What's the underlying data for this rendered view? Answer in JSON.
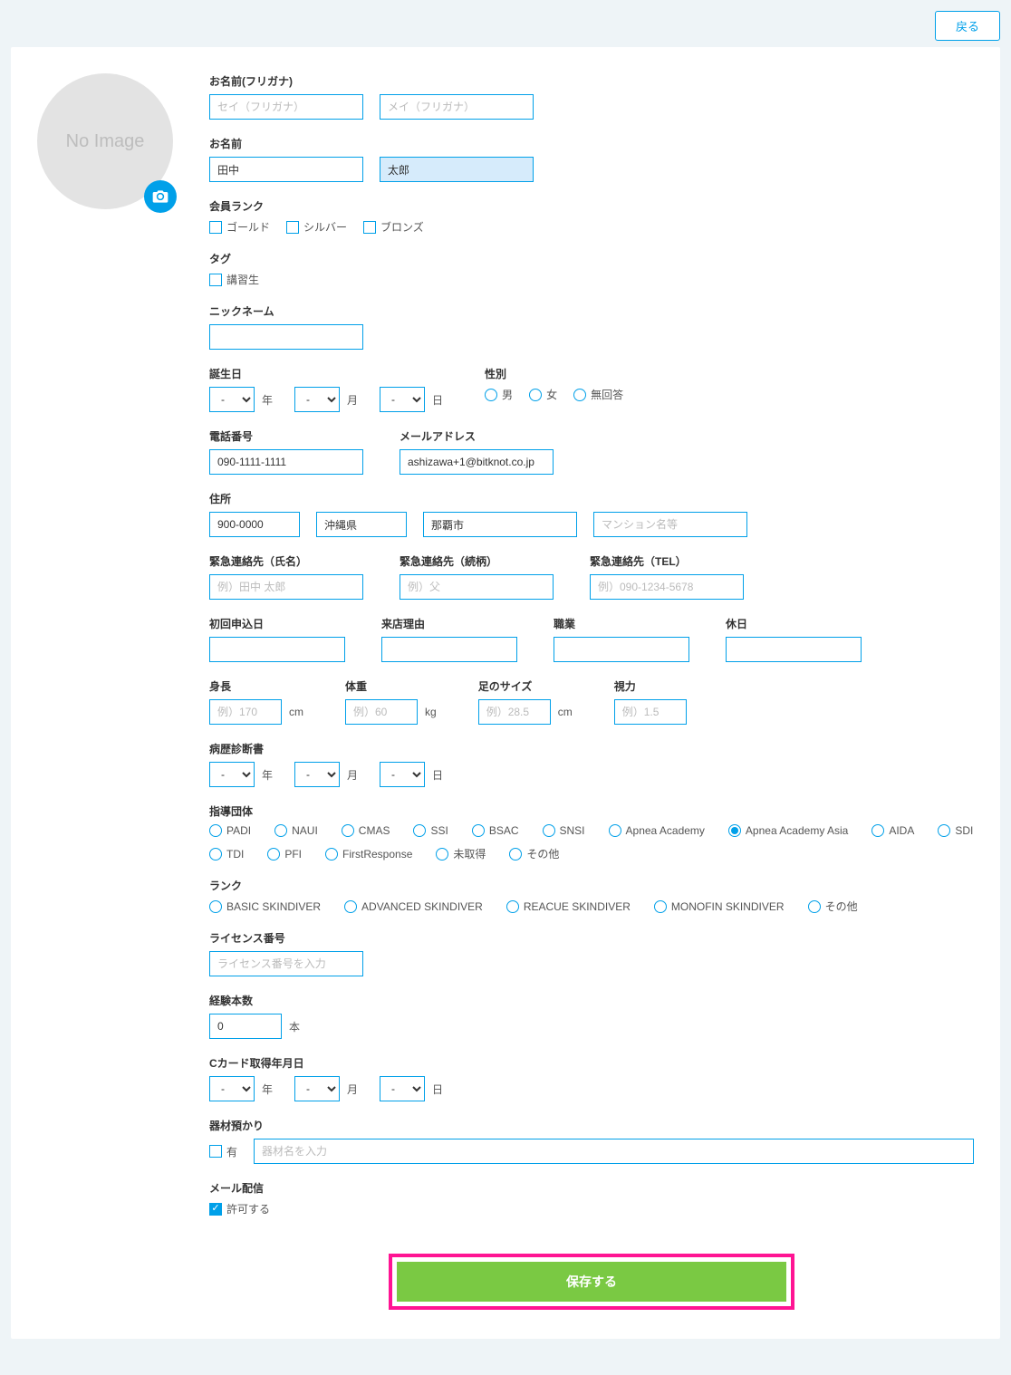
{
  "header": {
    "back": "戻る"
  },
  "avatar": {
    "placeholder": "No Image"
  },
  "furigana": {
    "label": "お名前(フリガナ)",
    "sei_ph": "セイ（フリガナ）",
    "mei_ph": "メイ（フリガナ）"
  },
  "name": {
    "label": "お名前",
    "sei": "田中",
    "mei": "太郎"
  },
  "rank": {
    "label": "会員ランク",
    "opts": [
      "ゴールド",
      "シルバー",
      "ブロンズ"
    ]
  },
  "tag": {
    "label": "タグ",
    "opts": [
      "講習生"
    ]
  },
  "nickname": {
    "label": "ニックネーム"
  },
  "birth": {
    "label": "誕生日",
    "year": "年",
    "month": "月",
    "day": "日",
    "dash": "-"
  },
  "gender": {
    "label": "性別",
    "opts": [
      "男",
      "女",
      "無回答"
    ]
  },
  "phone": {
    "label": "電話番号",
    "value": "090-1111-1111"
  },
  "email": {
    "label": "メールアドレス",
    "value": "ashizawa+1@bitknot.co.jp"
  },
  "address": {
    "label": "住所",
    "zip": "900-0000",
    "pref": "沖縄県",
    "city": "那覇市",
    "bldg_ph": "マンション名等"
  },
  "emerg": {
    "name_label": "緊急連絡先（氏名）",
    "name_ph": "例）田中 太郎",
    "rel_label": "緊急連絡先（続柄）",
    "rel_ph": "例）父",
    "tel_label": "緊急連絡先（TEL）",
    "tel_ph": "例）090-1234-5678"
  },
  "first": {
    "label": "初回申込日"
  },
  "reason": {
    "label": "来店理由"
  },
  "job": {
    "label": "職業"
  },
  "holiday": {
    "label": "休日"
  },
  "body": {
    "height_label": "身長",
    "height_ph": "例）170",
    "height_unit": "cm",
    "weight_label": "体重",
    "weight_ph": "例）60",
    "weight_unit": "kg",
    "foot_label": "足のサイズ",
    "foot_ph": "例）28.5",
    "foot_unit": "cm",
    "eye_label": "視力",
    "eye_ph": "例）1.5"
  },
  "medical": {
    "label": "病歴診断書",
    "year": "年",
    "month": "月",
    "day": "日",
    "dash": "-"
  },
  "org": {
    "label": "指導団体",
    "opts": [
      "PADI",
      "NAUI",
      "CMAS",
      "SSI",
      "BSAC",
      "SNSI",
      "Apnea Academy",
      "Apnea Academy Asia",
      "AIDA",
      "SDI",
      "TDI",
      "PFI",
      "FirstResponse",
      "未取得",
      "その他"
    ],
    "selected": "Apnea Academy Asia"
  },
  "level": {
    "label": "ランク",
    "opts": [
      "BASIC SKINDIVER",
      "ADVANCED SKINDIVER",
      "REACUE SKINDIVER",
      "MONOFIN SKINDIVER",
      "その他"
    ]
  },
  "license": {
    "label": "ライセンス番号",
    "ph": "ライセンス番号を入力"
  },
  "exp": {
    "label": "経験本数",
    "value": "0",
    "unit": "本"
  },
  "ccard": {
    "label": "Cカード取得年月日",
    "year": "年",
    "month": "月",
    "day": "日",
    "dash": "-"
  },
  "equip": {
    "label": "器材預かり",
    "check": "有",
    "ph": "器材名を入力"
  },
  "mail": {
    "label": "メール配信",
    "check": "許可する"
  },
  "save": {
    "label": "保存する"
  }
}
